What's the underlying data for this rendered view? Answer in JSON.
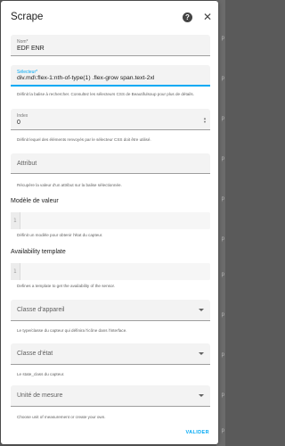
{
  "dialog": {
    "title": "Scrape",
    "submit_label": "VALIDER"
  },
  "fields": {
    "name": {
      "label": "Nom*",
      "value": "EDF ENR"
    },
    "selector": {
      "label": "Sélecteur*",
      "value": "div.md\\:flex-1:nth-of-type(1) .flex-grow span.text-2xl",
      "helper": "Définit la balise à rechercher. Consultez les sélecteurs CSS de Beautifulsoup pour plus de détails."
    },
    "index": {
      "label": "Index",
      "value": "0",
      "helper": "Définit lequel des éléments renvoyés par le sélecteur CSS doit être utilisé."
    },
    "attribute": {
      "label": "Attribut",
      "helper": "Récupère la valeur d'un attribut sur la balise sélectionnée."
    },
    "value_template": {
      "label": "Modèle de valeur",
      "line": "1",
      "helper": "Définit un modèle pour obtenir l'état du capteur."
    },
    "availability_template": {
      "label": "Availability template",
      "line": "1",
      "helper": "Defines a template to get the availability of the sensor."
    },
    "device_class": {
      "label": "Classe d'appareil",
      "helper": "Le type/classe du capteur qui définira l'icône dans l'interface."
    },
    "state_class": {
      "label": "Classe d'état",
      "helper": "Le state_class du capteur."
    },
    "unit": {
      "label": "Unité de mesure",
      "helper": "Choose unit of measurement or create your own."
    }
  },
  "icons": {
    "help": "help-circle-icon",
    "close": "close-icon",
    "dropdown": "menu-down-icon"
  },
  "colors": {
    "accent": "#03a9f4",
    "field_bg": "#f3f3f3",
    "backdrop": "#5a5a5a"
  }
}
